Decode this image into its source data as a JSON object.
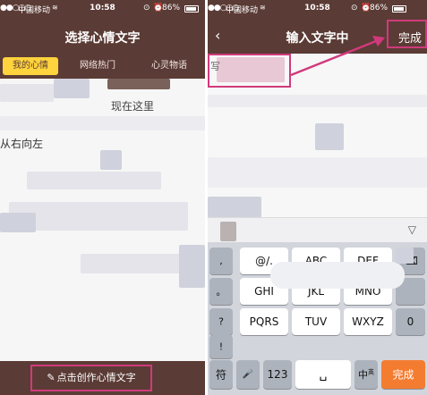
{
  "left_screen": {
    "status": {
      "carrier": "中国移动",
      "time": "10:58",
      "battery": "86%"
    },
    "title": "选择心情文字",
    "tabs": [
      "我的心情",
      "网络热门",
      "心灵物语"
    ],
    "lines": [
      "现在这里",
      "从右向左"
    ],
    "create_button": "点击创作心情文字"
  },
  "right_screen": {
    "status": {
      "carrier": "中国移动",
      "time": "10:58",
      "battery": "86%"
    },
    "title": "输入文字中",
    "done": "完成",
    "input_char": "写",
    "keyboard": {
      "side_keys": [
        ",",
        "。",
        "?",
        "!"
      ],
      "row1": [
        "@/.",
        "ABC",
        "DEF"
      ],
      "row2": [
        "GHI",
        "JKL",
        "MNO"
      ],
      "row3": [
        "PQRS",
        "TUV",
        "WXYZ"
      ],
      "delete_icon": "⌫",
      "row3_right": "0",
      "bottom": {
        "symbols": "符",
        "mic_icon": "🎤",
        "numbers": "123",
        "lang_main": "中",
        "lang_sub": "英",
        "enter": "完成"
      }
    }
  },
  "colors": {
    "brown": "#5b3b35",
    "tab_active": "#ffd33d",
    "highlight": "#d03a7c",
    "enter_key": "#f47c31"
  }
}
